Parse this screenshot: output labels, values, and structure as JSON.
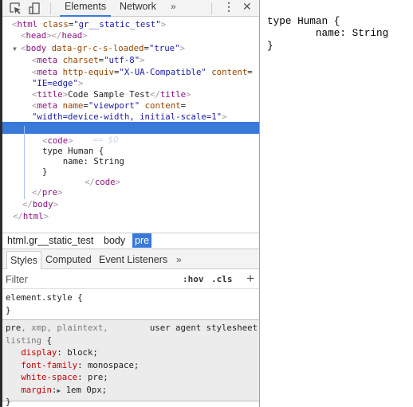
{
  "toolbar": {
    "inspect_icon": "element-picker-icon",
    "device_icon": "device-toolbar-icon",
    "tabs": [
      {
        "label": "Elements",
        "active": true
      },
      {
        "label": "Network",
        "active": false
      }
    ],
    "more_tabs": "»",
    "menu_icon": "⋮",
    "close_icon": "✕"
  },
  "dom": {
    "lines": {
      "html_open_tag": "html",
      "html_attr": "class",
      "html_val": "\"gr__static_test\"",
      "head": "head",
      "body_tag": "body",
      "body_attr": "data-gr-c-s-loaded",
      "body_val": "\"true\"",
      "meta1_attr": "charset",
      "meta1_val": "\"utf-8\"",
      "meta2_attr": "http-equiv",
      "meta2_val": "\"X-UA-Compatible\"",
      "meta2_attr2": "content",
      "meta2_val2": "\"IE=edge\"",
      "title_text": "Code Sample Test",
      "meta3_attr": "name",
      "meta3_val": "\"viewport\"",
      "meta3_attr2": "content",
      "meta3_val2": "\"width=device-width, initial-scale=1\"",
      "pre_tag": "pre",
      "selected_marker": "== $0",
      "code_line1": "type Human {",
      "code_line2": "    name: String",
      "code_line3": "}",
      "dots": "..."
    }
  },
  "breadcrumbs": [
    {
      "label": "html.gr__static_test",
      "active": false
    },
    {
      "label": "body",
      "active": false
    },
    {
      "label": "pre",
      "active": true
    }
  ],
  "styles_tabs": [
    {
      "label": "Styles",
      "active": true
    },
    {
      "label": "Computed",
      "active": false
    },
    {
      "label": "Event Listeners",
      "active": false
    }
  ],
  "styles_more": "»",
  "filter": {
    "placeholder": "Filter",
    "hov": ":hov",
    "cls": ".cls",
    "add": "+"
  },
  "rules": {
    "element_style": {
      "selector": "element.style {",
      "close": "}"
    },
    "ua": {
      "selector_main": "pre",
      "selector_rest": ", xmp, plaintext,",
      "selector_line2": "listing {",
      "origin": "user agent stylesheet",
      "props": [
        {
          "name": "display",
          "value": "block;"
        },
        {
          "name": "font-family",
          "value": "monospace;"
        },
        {
          "name": "white-space",
          "value": "pre;"
        },
        {
          "name": "margin",
          "value": "1em 0px;"
        }
      ],
      "close": "}"
    }
  },
  "page": {
    "code": "type Human {\n        name: String\n}"
  }
}
